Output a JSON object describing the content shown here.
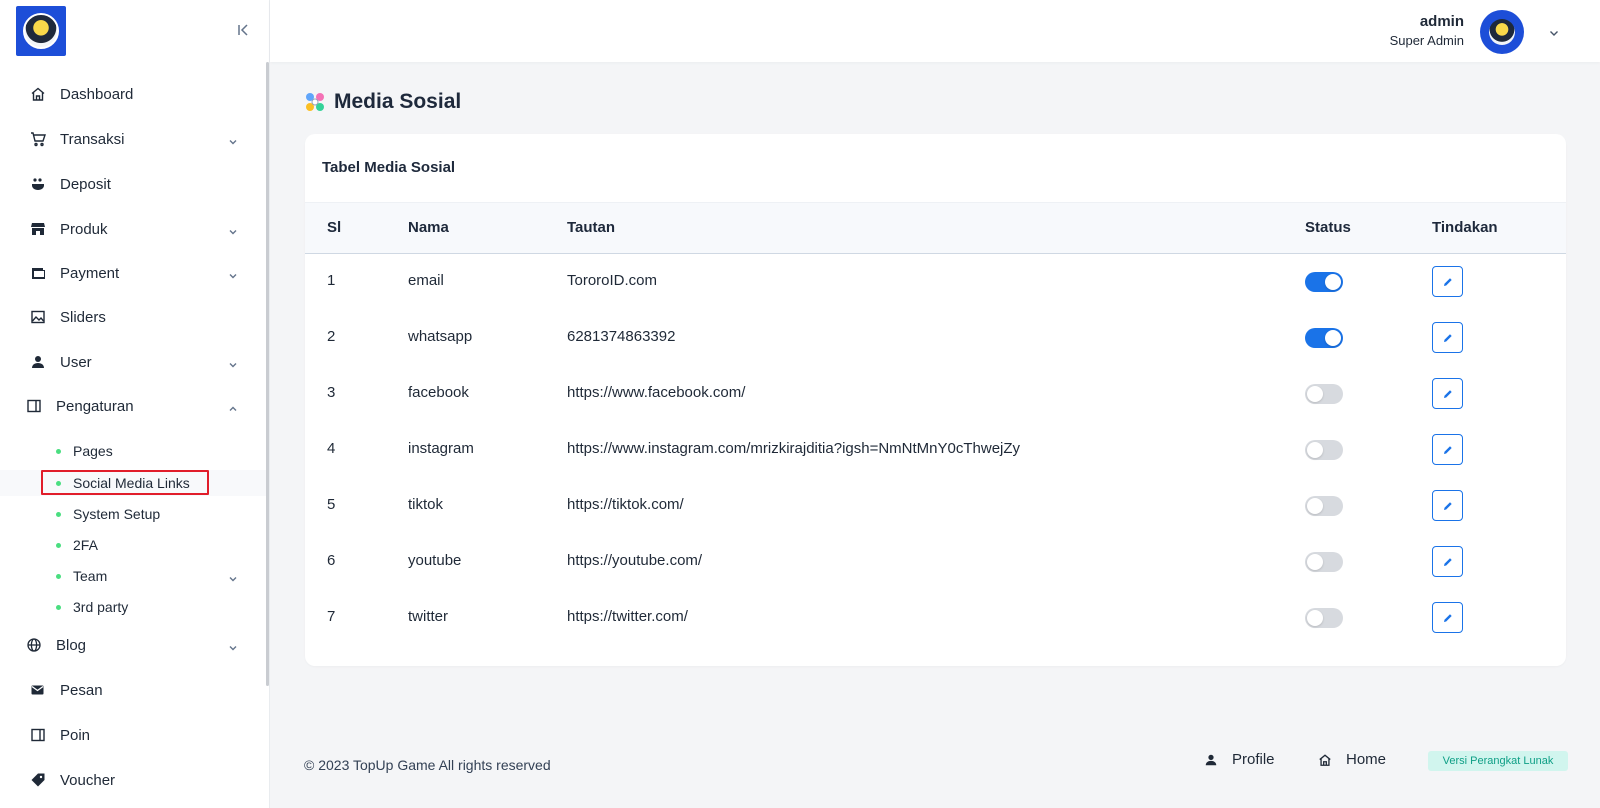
{
  "brand": {
    "logo_icon": "mascot-logo"
  },
  "user": {
    "name": "admin",
    "role": "Super Admin"
  },
  "sidebar": {
    "items": [
      {
        "label": "Dashboard",
        "icon": "home-icon"
      },
      {
        "label": "Transaksi",
        "icon": "cart-icon"
      },
      {
        "label": "Deposit",
        "icon": "deposit-icon"
      },
      {
        "label": "Produk",
        "icon": "store-icon"
      },
      {
        "label": "Payment",
        "icon": "wallet-icon"
      },
      {
        "label": "Sliders",
        "icon": "image-icon"
      },
      {
        "label": "User",
        "icon": "user-icon"
      },
      {
        "label": "Pengaturan",
        "icon": "settings-panel-icon"
      },
      {
        "label": "Blog",
        "icon": "globe-icon"
      },
      {
        "label": "Pesan",
        "icon": "mail-icon"
      },
      {
        "label": "Poin",
        "icon": "panel-icon"
      },
      {
        "label": "Voucher",
        "icon": "tag-icon"
      }
    ],
    "pengaturan_sub": [
      {
        "label": "Pages"
      },
      {
        "label": "Social Media Links"
      },
      {
        "label": "System Setup"
      },
      {
        "label": "2FA"
      },
      {
        "label": "Team"
      },
      {
        "label": "3rd party"
      }
    ]
  },
  "page": {
    "title": "Media Sosial"
  },
  "card": {
    "title": "Tabel Media Sosial"
  },
  "table": {
    "columns": [
      "Sl",
      "Nama",
      "Tautan",
      "Status",
      "Tindakan"
    ],
    "rows": [
      {
        "sl": "1",
        "nama": "email",
        "tautan": "TororoID.com",
        "status": true
      },
      {
        "sl": "2",
        "nama": "whatsapp",
        "tautan": "6281374863392",
        "status": true
      },
      {
        "sl": "3",
        "nama": "facebook",
        "tautan": "https://www.facebook.com/",
        "status": false
      },
      {
        "sl": "4",
        "nama": "instagram",
        "tautan": "https://www.instagram.com/mrizkirajditia?igsh=NmNtMnY0cThwejZy",
        "status": false
      },
      {
        "sl": "5",
        "nama": "tiktok",
        "tautan": "https://tiktok.com/",
        "status": false
      },
      {
        "sl": "6",
        "nama": "youtube",
        "tautan": "https://youtube.com/",
        "status": false
      },
      {
        "sl": "7",
        "nama": "twitter",
        "tautan": "https://twitter.com/",
        "status": false
      }
    ]
  },
  "footer": {
    "copyright": "© 2023 TopUp Game All rights reserved",
    "profile_label": "Profile",
    "home_label": "Home",
    "version_label": "Versi Perangkat Lunak"
  },
  "colors": {
    "accent": "#1a73e8",
    "sub_dot": "#4ade80",
    "highlight": "#e11d2a",
    "badge_bg": "#d1f5ee",
    "badge_text": "#0f9f86"
  }
}
